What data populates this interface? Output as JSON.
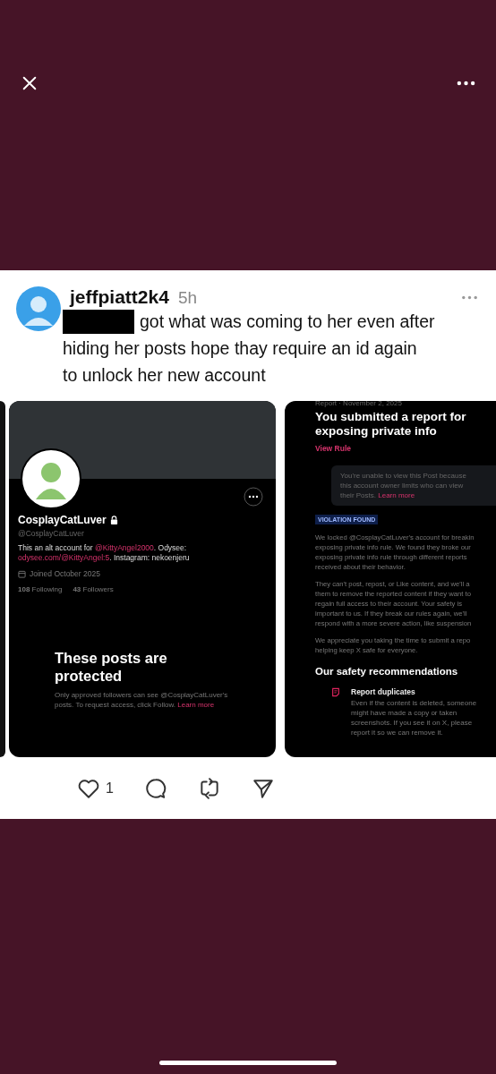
{
  "post": {
    "username": "jeffpiatt2k4",
    "time": "5h",
    "text_lines": [
      "got what was coming to her even after",
      "hiding her posts hope thay require an id again",
      "to unlock her new account"
    ],
    "likes": "1"
  },
  "profile_screenshot": {
    "name": "CosplayCatLuver",
    "handle": "@CosplayCatLuver",
    "bio": [
      {
        "kind": "text",
        "text": "This an alt account for "
      },
      {
        "kind": "link",
        "text": "@KittyAngel2000"
      },
      {
        "kind": "text",
        "text": ". Odysee: "
      },
      {
        "kind": "link",
        "text": "odysee.com/"
      },
      {
        "kind": "link",
        "text": "@KittyAngel:5"
      },
      {
        "kind": "text",
        "text": ". Instagram: nekoenjeru"
      }
    ],
    "joined": "Joined October 2025",
    "stats": [
      "**108** Following",
      "**43** Followers"
    ],
    "protected_title": "These posts are protected",
    "protected_text": "Only approved followers can see @CosplayCatLuver's posts. To request access, click Follow.",
    "protected_link": "Learn more"
  },
  "report_screenshot": {
    "meta": "Report · November 2, 2025",
    "title": "You submitted a report for exposing private info",
    "rule_link": "View Rule",
    "notice": "You're unable to view this Post because this account owner limits who can view their Posts.",
    "notice_link": "Learn more",
    "badge": "VIOLATION FOUND",
    "paragraphs": [
      [
        "We locked @CosplayCatLuver's account for breakin",
        "exposing private info rule. We found they broke our",
        "exposing private info rule through different reports",
        "received about their behavior."
      ],
      [
        "They can't post, repost, or Like content, and we'll a",
        "them to remove the reported content if they want to",
        "regain full access to their account. Your safety is",
        "important to us. If they break our rules again, we'll",
        "respond with a more severe action, like suspension"
      ],
      [
        "We appreciate you taking the time to submit a repo",
        "helping keep X safe for everyone."
      ]
    ],
    "section_title": "Our safety recommendations",
    "recommendation": {
      "title": "Report duplicates",
      "text": "Even if the content is deleted, someone might have made a copy or taken screenshots. If you see it on X, please report it so we can remove it."
    }
  }
}
